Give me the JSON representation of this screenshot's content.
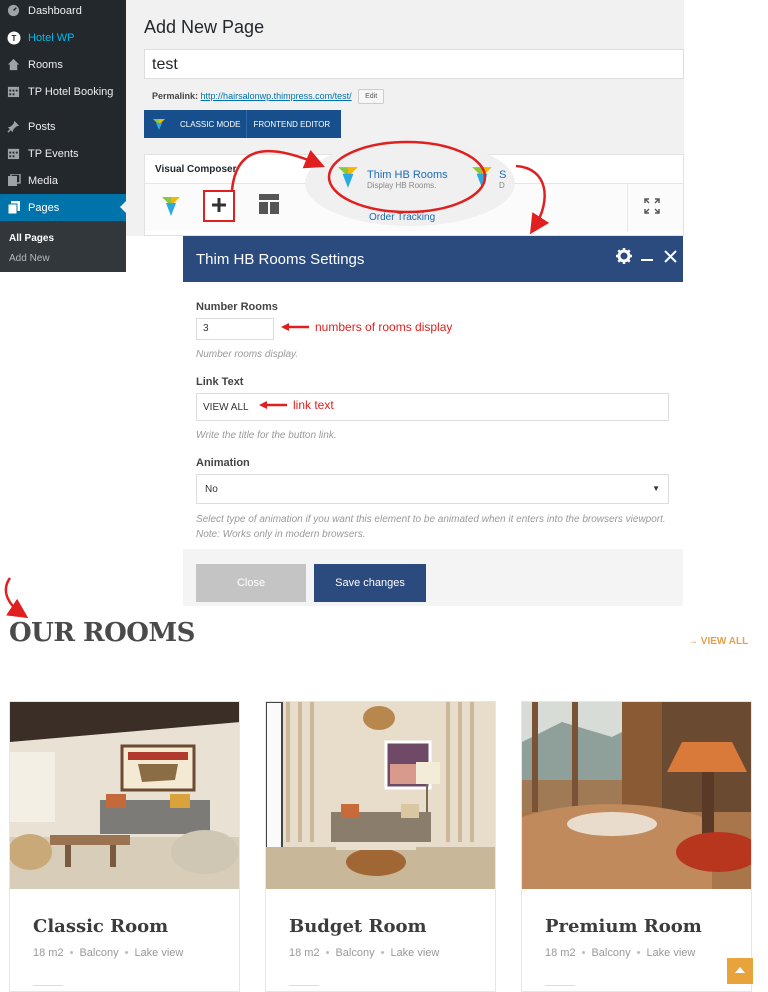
{
  "sidebar": {
    "items": [
      {
        "label": "Dashboard",
        "icon": "dashboard-icon"
      },
      {
        "label": "Hotel WP",
        "icon": "hotel-wp-icon"
      },
      {
        "label": "Rooms",
        "icon": "home-icon"
      },
      {
        "label": "TP Hotel Booking",
        "icon": "calendar-icon"
      },
      {
        "label": "Posts",
        "icon": "pin-icon"
      },
      {
        "label": "TP Events",
        "icon": "calendar-icon"
      },
      {
        "label": "Media",
        "icon": "media-icon"
      },
      {
        "label": "Pages",
        "icon": "pages-icon"
      }
    ],
    "submenu": [
      "All Pages",
      "Add New"
    ]
  },
  "editor": {
    "heading": "Add New Page",
    "title_value": "test",
    "permalink_label": "Permalink:",
    "permalink_url": "http://hairsalonwp.thimpress.com/test/",
    "edit_label": "Edit",
    "classic_mode": "CLASSIC MODE",
    "frontend_editor": "FRONTEND EDITOR",
    "vc_title": "Visual Composer"
  },
  "element_popup": {
    "name": "Thim HB Rooms",
    "description": "Display HB Rooms.",
    "second_name": "S",
    "second_desc": "D",
    "peek": "Order Tracking"
  },
  "modal": {
    "title": "Thim HB Rooms Settings",
    "number_rooms_label": "Number Rooms",
    "number_rooms_value": "3",
    "number_rooms_help": "Number rooms display.",
    "link_text_label": "Link Text",
    "link_text_value": "VIEW ALL",
    "link_text_help": "Write the title for the button link.",
    "animation_label": "Animation",
    "animation_value": "No",
    "animation_help": "Select type of animation if you want this element to be animated when it enters into the browsers viewport. Note: Works only in modern browsers.",
    "close_label": "Close",
    "save_label": "Save changes"
  },
  "annotations": {
    "rooms": "numbers of rooms display",
    "link": "link text",
    "color": "#e02020"
  },
  "preview": {
    "heading": "OUR ROOMS",
    "view_all": "VIEW ALL",
    "rooms": [
      {
        "name": "Classic Room",
        "size": "18 m2",
        "feature1": "Balcony",
        "feature2": "Lake view"
      },
      {
        "name": "Budget Room",
        "size": "18 m2",
        "feature1": "Balcony",
        "feature2": "Lake view"
      },
      {
        "name": "Premium Room",
        "size": "18 m2",
        "feature1": "Balcony",
        "feature2": "Lake view"
      }
    ]
  },
  "colors": {
    "admin_bar": "#23282d",
    "admin_active": "#0073aa",
    "modal_header": "#2b4a7e",
    "accent_orange": "#e8a33d"
  }
}
